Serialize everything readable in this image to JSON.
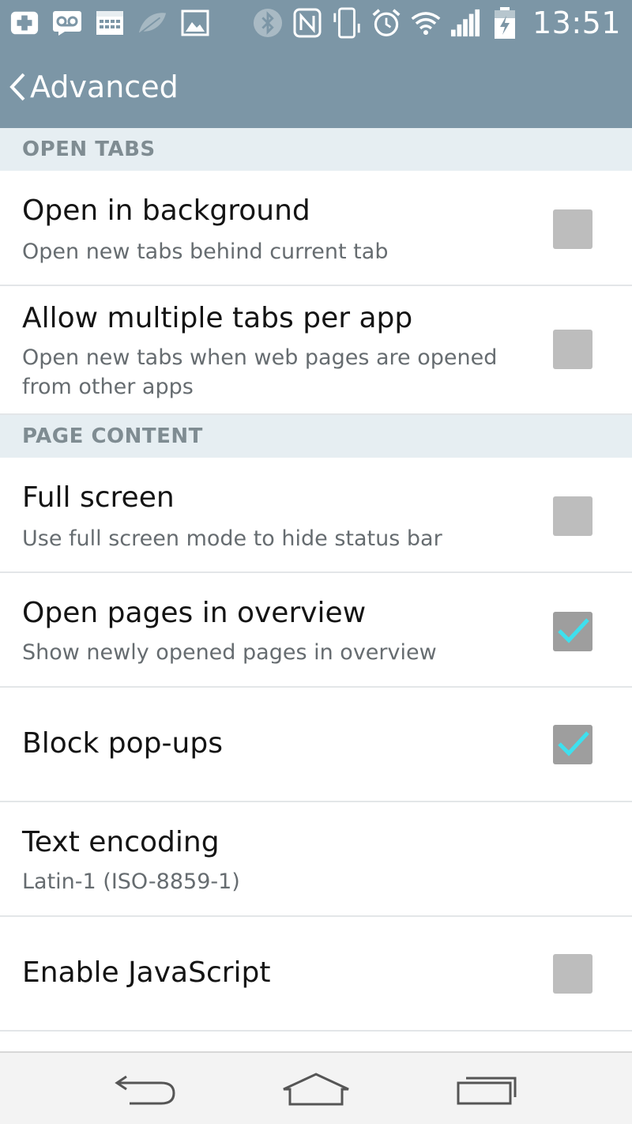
{
  "status_bar": {
    "time": "13:51",
    "left_icons": [
      "add-icon",
      "voicemail-icon",
      "calendar-icon",
      "leaf-icon",
      "image-icon"
    ],
    "right_icons": [
      "bluetooth-icon",
      "nfc-icon",
      "vibrate-icon",
      "alarm-icon",
      "wifi-icon",
      "signal-icon",
      "battery-charging-icon"
    ]
  },
  "action_bar": {
    "title": "Advanced",
    "back_icon": "chevron-left-icon"
  },
  "sections": {
    "open_tabs": {
      "header": "OPEN TABS",
      "items": [
        {
          "title": "Open in background",
          "summary": "Open new tabs behind current tab",
          "checked": false
        },
        {
          "title": "Allow multiple tabs per app",
          "summary_line1": "Open new tabs when web pages are opened",
          "summary_line2": "from other apps",
          "checked": false
        }
      ]
    },
    "page_content": {
      "header": "PAGE CONTENT",
      "items": [
        {
          "title": "Full screen",
          "summary": "Use full screen mode to hide status bar",
          "checked": false
        },
        {
          "title": "Open pages in overview",
          "summary": "Show newly opened pages in overview",
          "checked": true
        },
        {
          "title": "Block pop-ups",
          "checked": true
        },
        {
          "title": "Text encoding",
          "summary": "Latin-1 (ISO-8859-1)"
        },
        {
          "title": "Enable JavaScript",
          "checked": false
        }
      ]
    }
  },
  "nav_bar": {
    "buttons": [
      "back-icon",
      "home-icon",
      "recent-apps-icon"
    ]
  },
  "colors": {
    "action_bar": "#7c96a6",
    "section_header_bg": "#e6eef2",
    "section_header_text": "#7f8c92",
    "checkmark": "#3ee0ee",
    "checkbox": "#bdbdbd"
  }
}
